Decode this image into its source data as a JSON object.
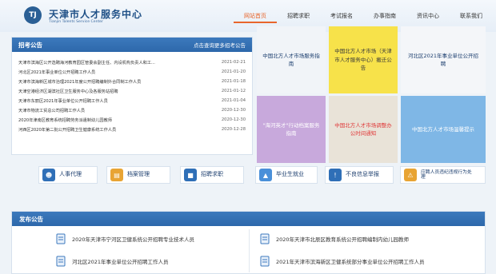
{
  "header": {
    "logo_text": "TJ",
    "title": "天津市人才服务中心",
    "subtitle": "Tianjin Talents Service Center"
  },
  "nav": [
    {
      "label": "网站首页",
      "active": true
    },
    {
      "label": "招聘求职",
      "active": false
    },
    {
      "label": "考试报名",
      "active": false
    },
    {
      "label": "办事指南",
      "active": false
    },
    {
      "label": "资讯中心",
      "active": false
    },
    {
      "label": "联系我们",
      "active": false
    }
  ],
  "notice": {
    "title": "招考公告",
    "more": "点击查询更多招考公告",
    "items": [
      {
        "text": "天津市滨海区公开选聘海河教育园区管委会副主任、内设机构负责人和工...",
        "date": "2021-02-21"
      },
      {
        "text": "河北区2021年事业单位公开招聘工作人员",
        "date": "2021-01-20"
      },
      {
        "text": "天津市滨海新区城市治理2021年度公开招聘编制外合同制工作人员",
        "date": "2021-01-18"
      },
      {
        "text": "天津空港经济区湖滨社区卫生服务中心及各服务站招聘",
        "date": "2021-01-12"
      },
      {
        "text": "天津市东丽区2021年事业单位公开招聘工作人员",
        "date": "2021-01-04"
      },
      {
        "text": "天津市物流工贸总公司招聘工作人员",
        "date": "2020-12-30"
      },
      {
        "text": "2020年津南区教育系统招聘劳务派遣制幼儿园教师",
        "date": "2020-12-30"
      },
      {
        "text": "河西区2020年第二批公开招聘卫生健康系统工作人员",
        "date": "2020-12-28"
      }
    ]
  },
  "tiles": {
    "t1": "中国北方人才市场服务指南",
    "t2": "中国北方人才市场（天津市人才服务中心）搬迁公告",
    "t3": "河北区2021年事业单位公开招聘",
    "t4": "\"海河英才\"行动档案服务指南",
    "t5": "中国北方人才市场调整办公时间通知",
    "t6": "中国北方人才市场温馨提示"
  },
  "quick_links": [
    {
      "label": "人事代理",
      "icon": "user-card-icon",
      "color": "#2f6fb7"
    },
    {
      "label": "档案管理",
      "icon": "folder-icon",
      "color": "#e8a434"
    },
    {
      "label": "招聘求职",
      "icon": "briefcase-icon",
      "color": "#2f6fb7"
    },
    {
      "label": "毕业生就业",
      "icon": "graduation-icon",
      "color": "#4a90d9"
    },
    {
      "label": "不良信息举报",
      "icon": "report-icon",
      "color": "#2f6fb7"
    },
    {
      "label": "应聘人员违纪违规行为处理",
      "icon": "warning-icon",
      "color": "#e8a434"
    }
  ],
  "publish": {
    "title": "发布公告",
    "items": [
      "2020年天津市宁河区卫健系统公开招聘专业技术人员",
      "2020年天津市北辰区教育系统公开招聘编制内幼儿园教师",
      "河北区2021年事业单位公开招聘工作人员",
      "2021年天津市滨海新区卫健系统部分事业单位公开招聘工作人员"
    ]
  }
}
